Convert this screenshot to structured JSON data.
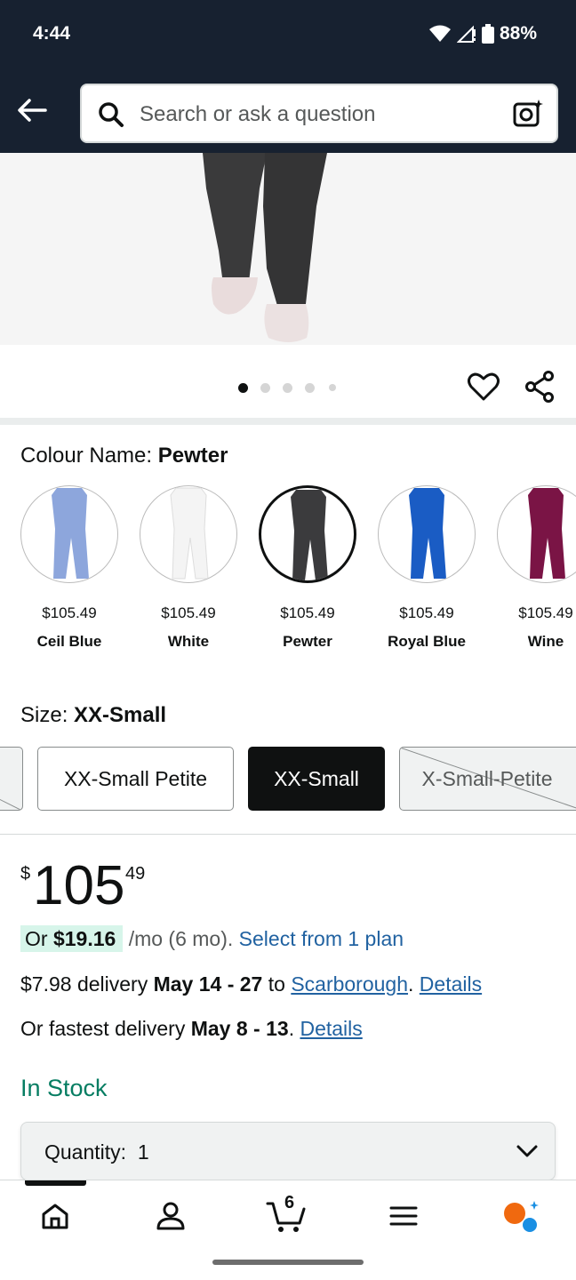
{
  "status_bar": {
    "time": "4:44",
    "battery": "88%"
  },
  "header": {
    "search_placeholder": "Search or ask a question"
  },
  "carousel": {
    "total_images": 5,
    "active_index": 0
  },
  "colour": {
    "label": "Colour Name: ",
    "selected": "Pewter",
    "options": [
      {
        "price": "$105.49",
        "name": "Ceil Blue",
        "color": "#8da6dc"
      },
      {
        "price": "$105.49",
        "name": "White",
        "color": "#f4f4f4"
      },
      {
        "price": "$105.49",
        "name": "Pewter",
        "color": "#3b3b3d"
      },
      {
        "price": "$105.49",
        "name": "Royal Blue",
        "color": "#1a5cc4"
      },
      {
        "price": "$105.49",
        "name": "Wine",
        "color": "#7a1445"
      }
    ]
  },
  "size": {
    "label": "Size: ",
    "selected": "XX-Small",
    "options": [
      {
        "label": "XX-Small Petite"
      },
      {
        "label": "XX-Small"
      },
      {
        "label": "X-Small-Petite"
      }
    ]
  },
  "price": {
    "symbol": "$",
    "whole": "105",
    "fraction": "49"
  },
  "plan": {
    "prefix": "Or ",
    "amount": "$19.16",
    "suffix": " /mo (6 mo). ",
    "link": "Select from 1 plan"
  },
  "delivery": {
    "standard_prefix": "$7.98 delivery ",
    "standard_dates": "May 14 - 27",
    "to": " to ",
    "location": "Scarborough",
    "details": "Details",
    "fastest_prefix": "Or fastest delivery ",
    "fastest_dates": "May 8 - 13",
    "details2": "Details"
  },
  "stock": "In Stock",
  "quantity": {
    "label": "Quantity:",
    "value": "1"
  },
  "nav": {
    "cart_count": "6"
  },
  "colors": {
    "header_bg": "#172130",
    "in_stock": "#067d62",
    "link": "#2162a1",
    "plan_bg": "#d7f5ea"
  }
}
